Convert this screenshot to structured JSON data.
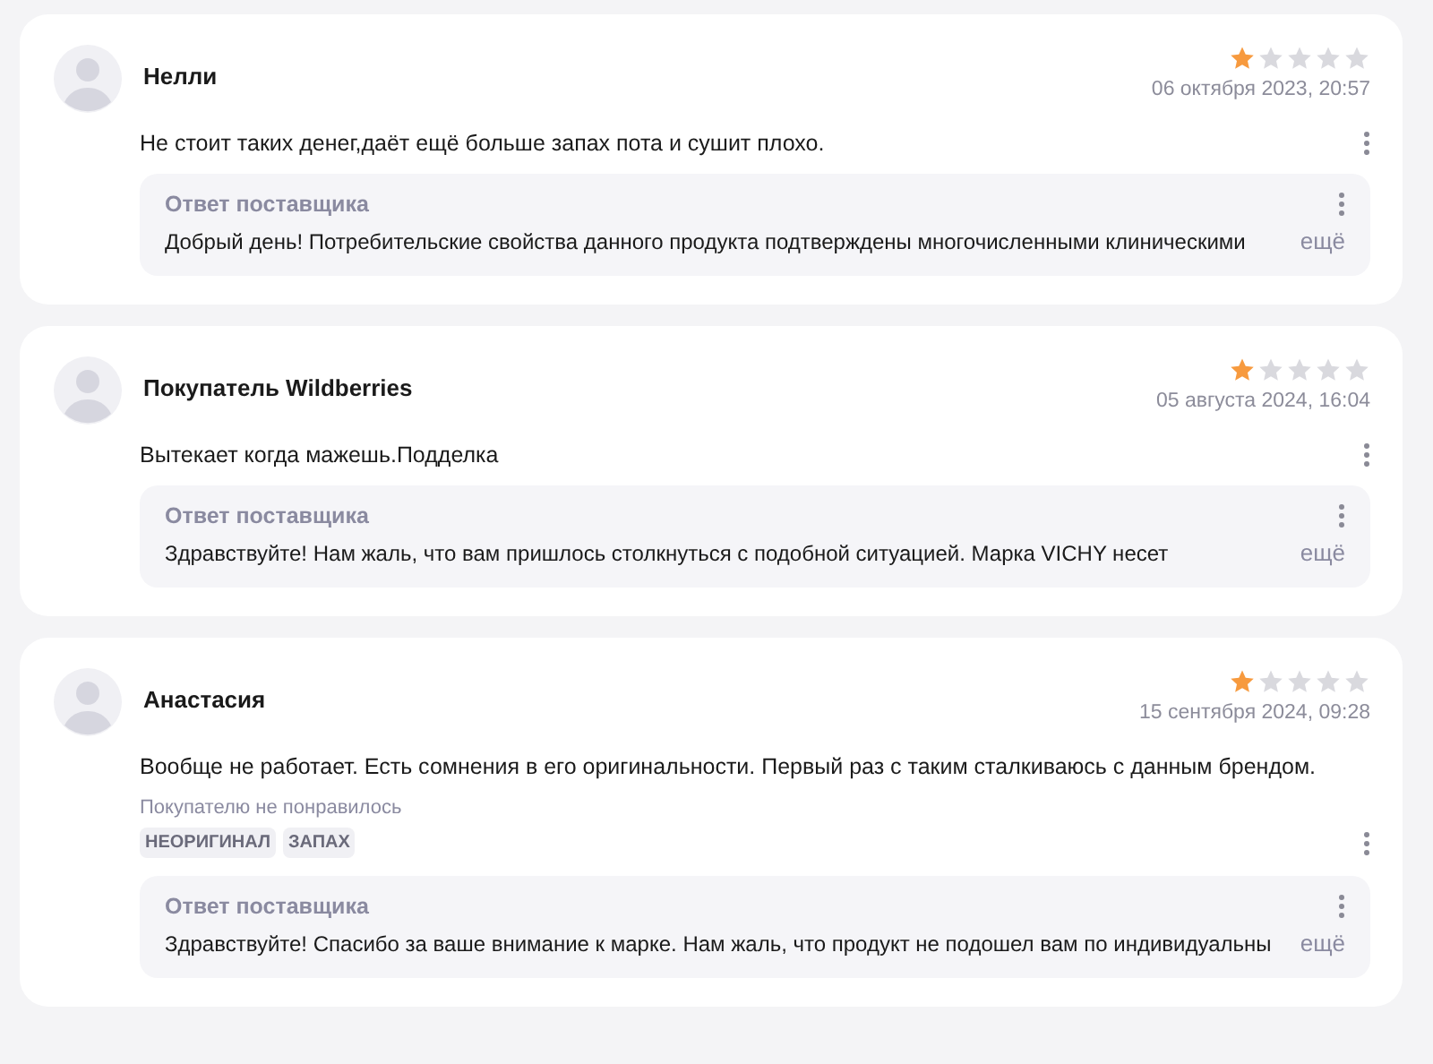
{
  "reviews": [
    {
      "author": "Нелли",
      "stars": 1,
      "date": "06 октября 2023, 20:57",
      "text": "Не стоит таких денег,даёт ещё больше запах пота и сушит плохо.",
      "reply": {
        "title": "Ответ поставщика",
        "text": "Добрый день! Потребительские свойства данного продукта подтверждены многочисленными клиническими",
        "more": "ещё"
      }
    },
    {
      "author": "Покупатель Wildberries",
      "stars": 1,
      "date": "05 августа 2024, 16:04",
      "text": "Вытекает когда мажешь.Подделка",
      "reply": {
        "title": "Ответ поставщика",
        "text": "Здравствуйте! Нам жаль, что вам пришлось столкнуться с подобной ситуацией. Марка VICHY несет",
        "more": "ещё"
      }
    },
    {
      "author": "Анастасия",
      "stars": 1,
      "date": "15 сентября 2024, 09:28",
      "text": "Вообще не работает. Есть сомнения в его оригинальности. Первый раз с таким сталкиваюсь с данным брендом.",
      "dislike_label": "Покупателю не понравилось",
      "tags": [
        "НЕОРИГИНАЛ",
        "ЗАПАХ"
      ],
      "reply": {
        "title": "Ответ поставщика",
        "text": "Здравствуйте! Спасибо за ваше внимание к марке. Нам жаль, что продукт не подошел вам по индивидуальны",
        "more": "ещё"
      }
    }
  ]
}
